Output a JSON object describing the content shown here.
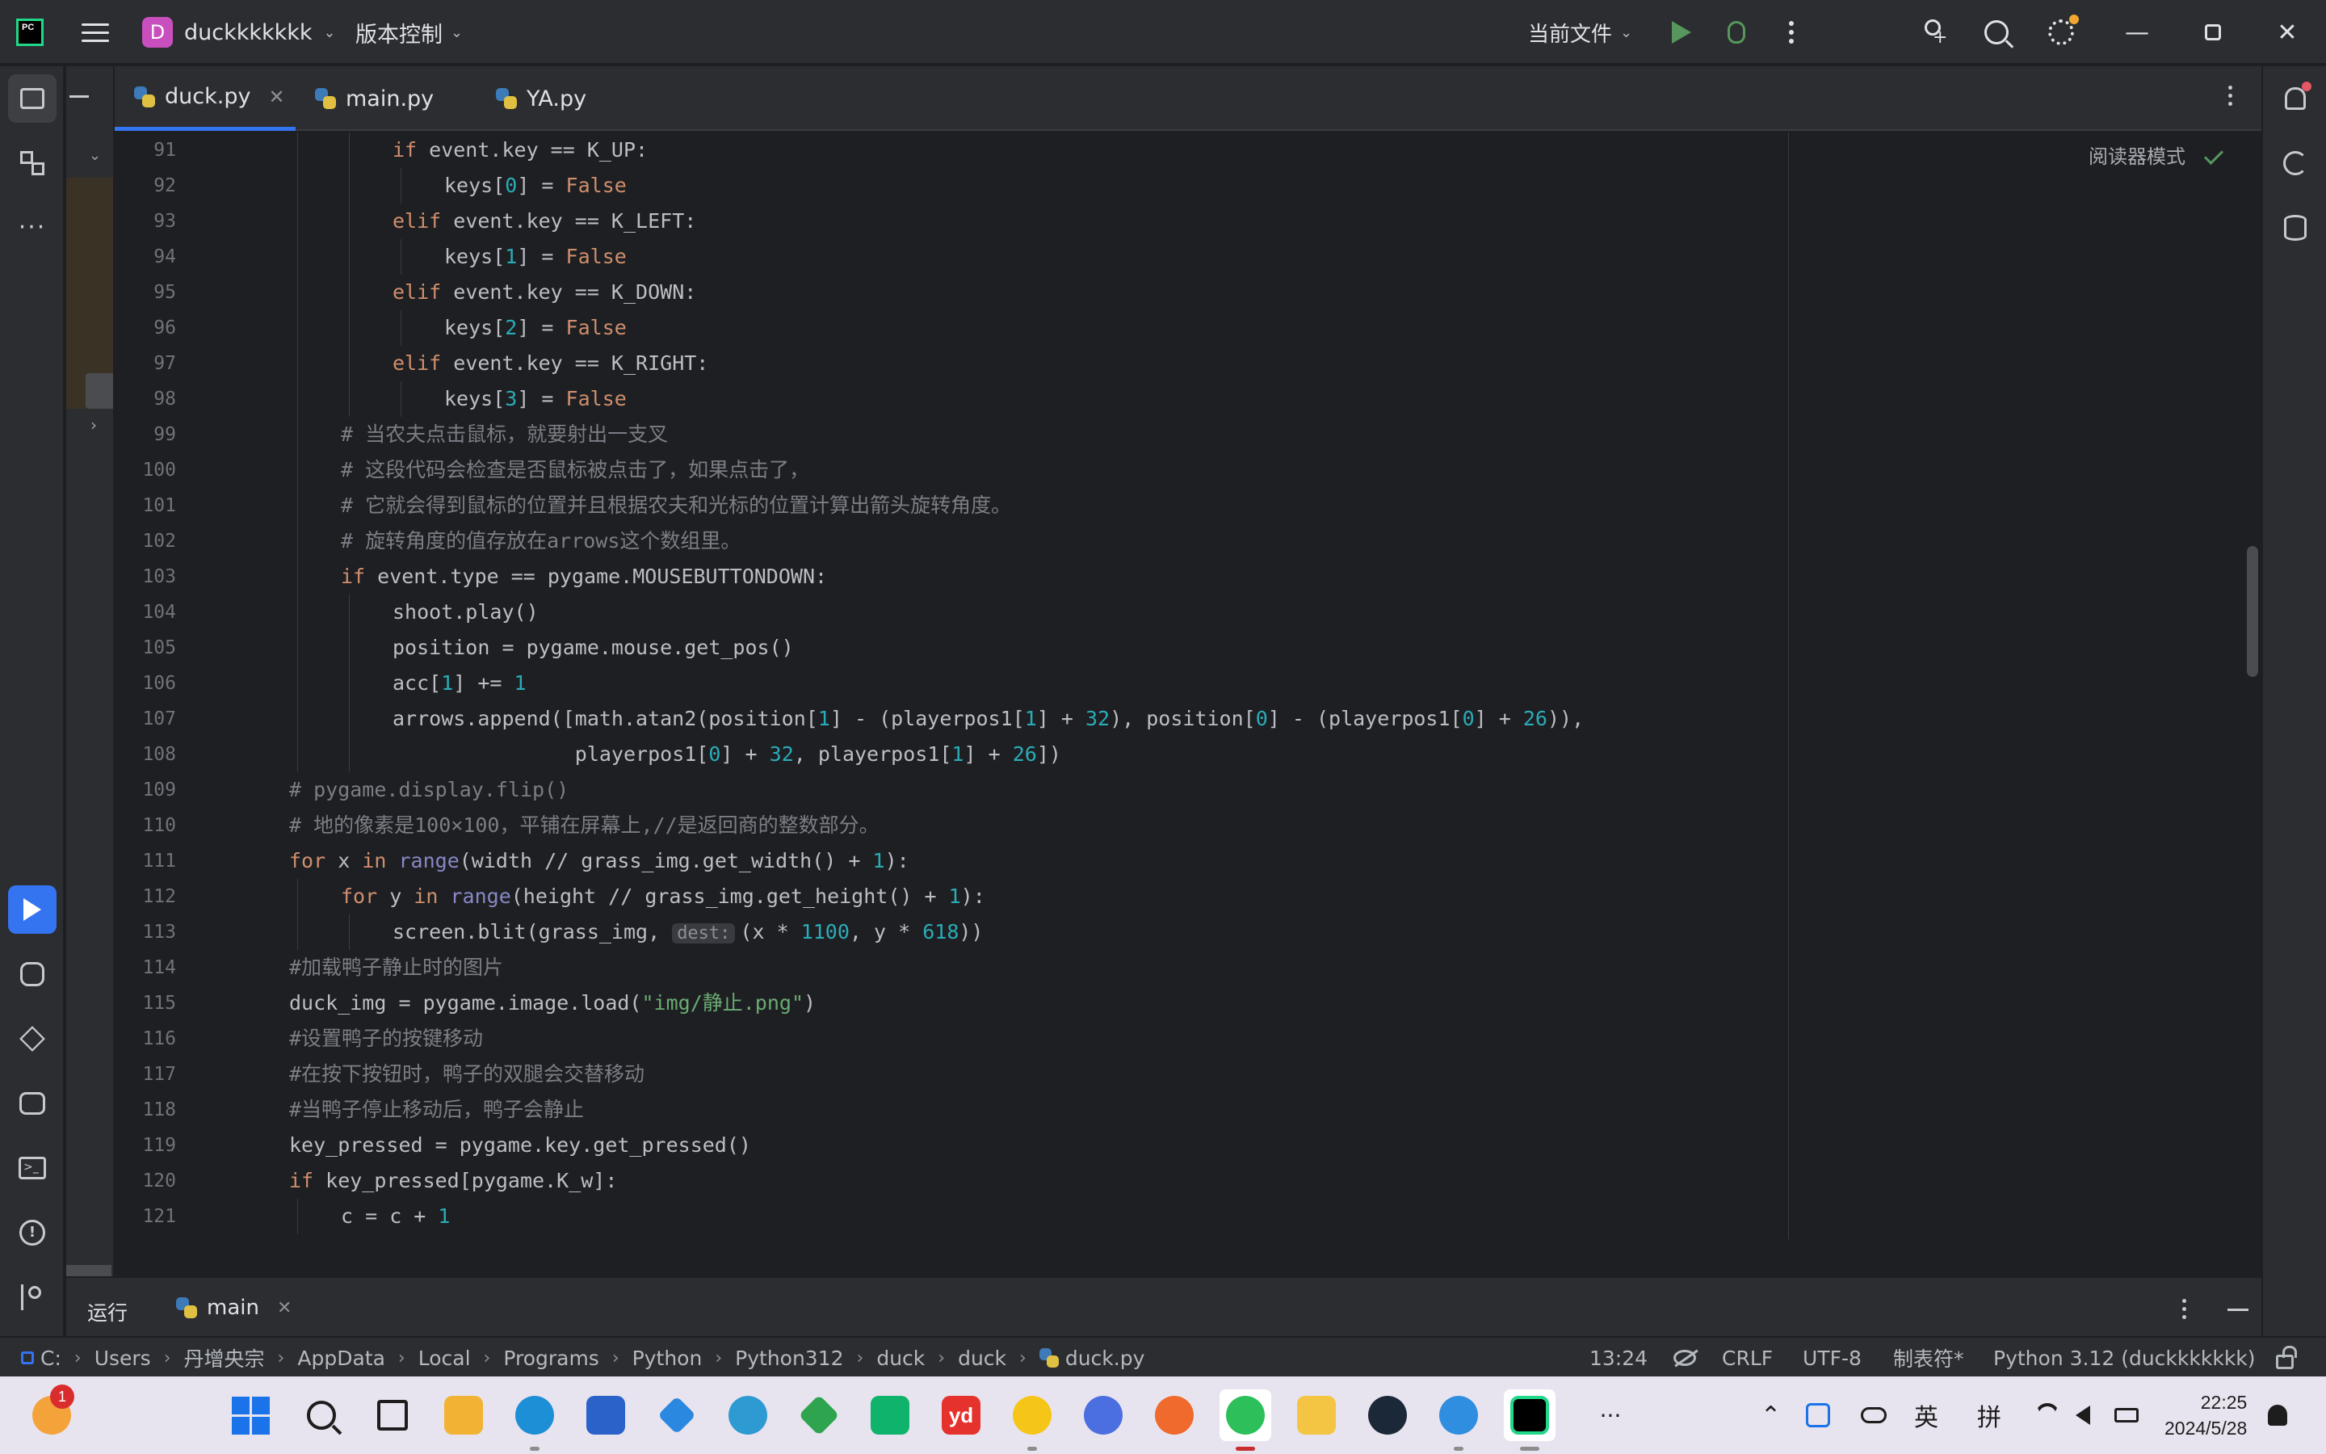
{
  "titlebar": {
    "logo_text": "PC",
    "project_badge": "D",
    "project_name": "duckkkkkkk",
    "vcs_label": "版本控制",
    "run_config": "当前文件"
  },
  "tabs": [
    {
      "label": "duck.py",
      "active": true
    },
    {
      "label": "main.py",
      "active": false
    },
    {
      "label": "YA.py",
      "active": false
    }
  ],
  "editor": {
    "reader_mode": "阅读器模式",
    "inlay_hint_dest": "dest:",
    "lines": [
      {
        "n": "91",
        "indent": 2,
        "seg": [
          [
            "kw",
            "if "
          ],
          [
            "t",
            "event.key == K_UP:"
          ]
        ]
      },
      {
        "n": "92",
        "indent": 3,
        "seg": [
          [
            "t",
            "keys["
          ],
          [
            "num",
            "0"
          ],
          [
            "t",
            "] = "
          ],
          [
            "kw",
            "False"
          ]
        ]
      },
      {
        "n": "93",
        "indent": 2,
        "seg": [
          [
            "kw",
            "elif "
          ],
          [
            "t",
            "event.key == K_LEFT:"
          ]
        ]
      },
      {
        "n": "94",
        "indent": 3,
        "seg": [
          [
            "t",
            "keys["
          ],
          [
            "num",
            "1"
          ],
          [
            "t",
            "] = "
          ],
          [
            "kw",
            "False"
          ]
        ]
      },
      {
        "n": "95",
        "indent": 2,
        "seg": [
          [
            "kw",
            "elif "
          ],
          [
            "t",
            "event.key == K_DOWN:"
          ]
        ]
      },
      {
        "n": "96",
        "indent": 3,
        "seg": [
          [
            "t",
            "keys["
          ],
          [
            "num",
            "2"
          ],
          [
            "t",
            "] = "
          ],
          [
            "kw",
            "False"
          ]
        ]
      },
      {
        "n": "97",
        "indent": 2,
        "seg": [
          [
            "kw",
            "elif "
          ],
          [
            "t",
            "event.key == K_RIGHT:"
          ]
        ]
      },
      {
        "n": "98",
        "indent": 3,
        "seg": [
          [
            "t",
            "keys["
          ],
          [
            "num",
            "3"
          ],
          [
            "t",
            "] = "
          ],
          [
            "kw",
            "False"
          ]
        ]
      },
      {
        "n": "99",
        "indent": 1,
        "seg": [
          [
            "cm",
            "# 当农夫点击鼠标，就要射出一支叉"
          ]
        ]
      },
      {
        "n": "100",
        "indent": 1,
        "seg": [
          [
            "cm",
            "# 这段代码会检查是否鼠标被点击了，如果点击了，"
          ]
        ]
      },
      {
        "n": "101",
        "indent": 1,
        "seg": [
          [
            "cm",
            "# 它就会得到鼠标的位置并且根据农夫和光标的位置计算出箭头旋转角度。"
          ]
        ]
      },
      {
        "n": "102",
        "indent": 1,
        "seg": [
          [
            "cm",
            "# 旋转角度的值存放在arrows这个数组里。"
          ]
        ]
      },
      {
        "n": "103",
        "indent": 1,
        "seg": [
          [
            "kw",
            "if "
          ],
          [
            "t",
            "event.type == pygame.MOUSEBUTTONDOWN:"
          ]
        ]
      },
      {
        "n": "104",
        "indent": 2,
        "seg": [
          [
            "t",
            "shoot.play()"
          ]
        ]
      },
      {
        "n": "105",
        "indent": 2,
        "seg": [
          [
            "t",
            "position = pygame.mouse.get_pos()"
          ]
        ]
      },
      {
        "n": "106",
        "indent": 2,
        "seg": [
          [
            "t",
            "acc["
          ],
          [
            "num",
            "1"
          ],
          [
            "t",
            "] += "
          ],
          [
            "num",
            "1"
          ]
        ]
      },
      {
        "n": "107",
        "indent": 2,
        "seg": [
          [
            "t",
            "arrows.append([math.atan2(position["
          ],
          [
            "num",
            "1"
          ],
          [
            "t",
            "] - (playerpos1["
          ],
          [
            "num",
            "1"
          ],
          [
            "t",
            "] + "
          ],
          [
            "num",
            "32"
          ],
          [
            "t",
            "), position["
          ],
          [
            "num",
            "0"
          ],
          [
            "t",
            "] - (playerpos1["
          ],
          [
            "num",
            "0"
          ],
          [
            "t",
            "] + "
          ],
          [
            "num",
            "26"
          ],
          [
            "t",
            ")),"
          ]
        ]
      },
      {
        "n": "108",
        "indent": 2,
        "pad": "               ",
        "seg": [
          [
            "t",
            "playerpos1["
          ],
          [
            "num",
            "0"
          ],
          [
            "t",
            "] + "
          ],
          [
            "num",
            "32"
          ],
          [
            "t",
            ", playerpos1["
          ],
          [
            "num",
            "1"
          ],
          [
            "t",
            "] + "
          ],
          [
            "num",
            "26"
          ],
          [
            "t",
            "])"
          ]
        ]
      },
      {
        "n": "109",
        "indent": 0,
        "seg": [
          [
            "cm",
            "# pygame.display.flip()"
          ]
        ]
      },
      {
        "n": "110",
        "indent": 0,
        "seg": [
          [
            "cm",
            "# 地的像素是100×100，平铺在屏幕上,//是返回商的整数部分。"
          ]
        ]
      },
      {
        "n": "111",
        "indent": 0,
        "seg": [
          [
            "kw",
            "for "
          ],
          [
            "t",
            "x "
          ],
          [
            "kw",
            "in "
          ],
          [
            "bi",
            "range"
          ],
          [
            "t",
            "(width // grass_img.get_width() + "
          ],
          [
            "num",
            "1"
          ],
          [
            "t",
            "):"
          ]
        ]
      },
      {
        "n": "112",
        "indent": 1,
        "seg": [
          [
            "kw",
            "for "
          ],
          [
            "t",
            "y "
          ],
          [
            "kw",
            "in "
          ],
          [
            "bi",
            "range"
          ],
          [
            "t",
            "(height // grass_img.get_height() + "
          ],
          [
            "num",
            "1"
          ],
          [
            "t",
            "):"
          ]
        ]
      },
      {
        "n": "113",
        "indent": 2,
        "seg": [
          [
            "t",
            "screen.blit(grass_img, "
          ],
          [
            "hint",
            "dest:"
          ],
          [
            "t",
            "(x * "
          ],
          [
            "num",
            "1100"
          ],
          [
            "t",
            ", y * "
          ],
          [
            "num",
            "618"
          ],
          [
            "t",
            "))"
          ]
        ]
      },
      {
        "n": "114",
        "indent": 0,
        "seg": [
          [
            "cm",
            "#加载鸭子静止时的图片"
          ]
        ]
      },
      {
        "n": "115",
        "indent": 0,
        "seg": [
          [
            "t",
            "duck_img = pygame.image.load("
          ],
          [
            "str",
            "\"img/静止.png\""
          ],
          [
            "t",
            ")"
          ]
        ]
      },
      {
        "n": "116",
        "indent": 0,
        "seg": [
          [
            "cm",
            "#设置鸭子的按键移动"
          ]
        ]
      },
      {
        "n": "117",
        "indent": 0,
        "seg": [
          [
            "cm",
            "#在按下按钮时，鸭子的双腿会交替移动"
          ]
        ]
      },
      {
        "n": "118",
        "indent": 0,
        "seg": [
          [
            "cm",
            "#当鸭子停止移动后，鸭子会静止"
          ]
        ]
      },
      {
        "n": "119",
        "indent": 0,
        "seg": [
          [
            "t",
            "key_pressed = pygame.key.get_pressed()"
          ]
        ]
      },
      {
        "n": "120",
        "indent": 0,
        "seg": [
          [
            "kw",
            "if "
          ],
          [
            "t",
            "key_pressed[pygame.K_w]:"
          ]
        ]
      },
      {
        "n": "121",
        "indent": 1,
        "seg": [
          [
            "t",
            "c = c + "
          ],
          [
            "num",
            "1"
          ]
        ]
      }
    ]
  },
  "bottom_panel": {
    "run_label": "运行",
    "run_tab": "main"
  },
  "statusbar": {
    "breadcrumbs": [
      "C:",
      "Users",
      "丹增央宗",
      "AppData",
      "Local",
      "Programs",
      "Python",
      "Python312",
      "duck",
      "duck",
      "duck.py"
    ],
    "position": "13:24",
    "line_sep": "CRLF",
    "encoding": "UTF-8",
    "indent": "制表符*",
    "interpreter": "Python 3.12 (duckkkkkkk)"
  },
  "taskbar": {
    "notif_badge": "1",
    "ime_lang": "英",
    "ime_mode": "拼",
    "time": "22:25",
    "date": "2024/5/28",
    "yd_label": "yd",
    "overflow": "···"
  },
  "colors": {
    "accent": "#3574f0",
    "run_green": "#57965c",
    "keyword": "#cf8e6d",
    "number": "#2aacb8",
    "string": "#6aab73",
    "comment": "#7a7e85"
  }
}
